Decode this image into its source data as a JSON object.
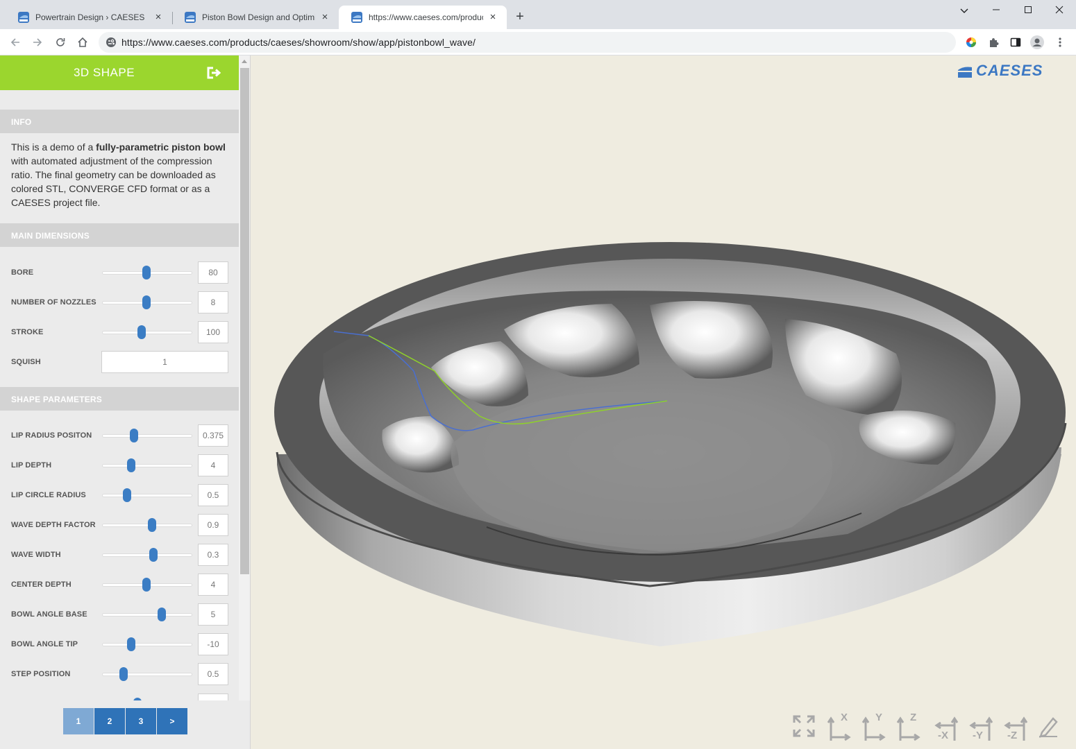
{
  "browser": {
    "tabs": [
      {
        "title": "Powertrain Design › CAESES",
        "active": false
      },
      {
        "title": "Piston Bowl Design and Optimiza",
        "active": false
      },
      {
        "title": "https://www.caeses.com/product",
        "active": true
      }
    ],
    "url": "https://www.caeses.com/products/caeses/showroom/show/app/pistonbowl_wave/"
  },
  "panel": {
    "title": "3D SHAPE",
    "info": {
      "heading": "INFO",
      "text_1": "This is a demo of a ",
      "text_bold": "fully-parametric piston bowl",
      "text_2": " with automated adjustment of the compression ratio. The final geometry can be downloaded as colored STL, CONVERGE CFD format or as a CAESES project file."
    },
    "main_dimensions": {
      "heading": "MAIN DIMENSIONS",
      "params": [
        {
          "label": "BORE",
          "value": "80",
          "slider": 0.49
        },
        {
          "label": "NUMBER OF NOZZLES",
          "value": "8",
          "slider": 0.49
        },
        {
          "label": "STROKE",
          "value": "100",
          "slider": 0.44
        }
      ],
      "squish": {
        "label": "SQUISH",
        "value": "1"
      }
    },
    "shape_parameters": {
      "heading": "SHAPE PARAMETERS",
      "params": [
        {
          "label": "LIP RADIUS POSITON",
          "value": "0.375",
          "slider": 0.35
        },
        {
          "label": "LIP DEPTH",
          "value": "4",
          "slider": 0.32
        },
        {
          "label": "LIP CIRCLE RADIUS",
          "value": "0.5",
          "slider": 0.28
        },
        {
          "label": "WAVE DEPTH FACTOR",
          "value": "0.9",
          "slider": 0.55
        },
        {
          "label": "WAVE WIDTH",
          "value": "0.3",
          "slider": 0.57
        },
        {
          "label": "CENTER DEPTH",
          "value": "4",
          "slider": 0.49
        },
        {
          "label": "BOWL ANGLE BASE",
          "value": "5",
          "slider": 0.66
        },
        {
          "label": "BOWL ANGLE TIP",
          "value": "-10",
          "slider": 0.32
        },
        {
          "label": "STEP POSITION",
          "value": "0.5",
          "slider": 0.24
        }
      ]
    },
    "pager": [
      "1",
      "2",
      "3",
      ">"
    ]
  },
  "viewport": {
    "logo_text": "CAESES",
    "view_buttons": [
      {
        "icon": "fit-view-icon",
        "label": ""
      },
      {
        "icon": "view-x-icon",
        "label": "X"
      },
      {
        "icon": "view-y-icon",
        "label": "Y"
      },
      {
        "icon": "view-z-icon",
        "label": "Z"
      },
      {
        "icon": "view-neg-x-icon",
        "label": "-X"
      },
      {
        "icon": "view-neg-y-icon",
        "label": "-Y"
      },
      {
        "icon": "view-neg-z-icon",
        "label": "-Z"
      },
      {
        "icon": "edit-icon",
        "label": ""
      }
    ]
  },
  "colors": {
    "header_green": "#9bd62e",
    "slider_blue": "#3b7dc4",
    "page_button_blue": "#2f73b8",
    "viewport_bg": "#efece0",
    "curve_green": "#8fd12a",
    "curve_blue": "#4a6fd0"
  }
}
